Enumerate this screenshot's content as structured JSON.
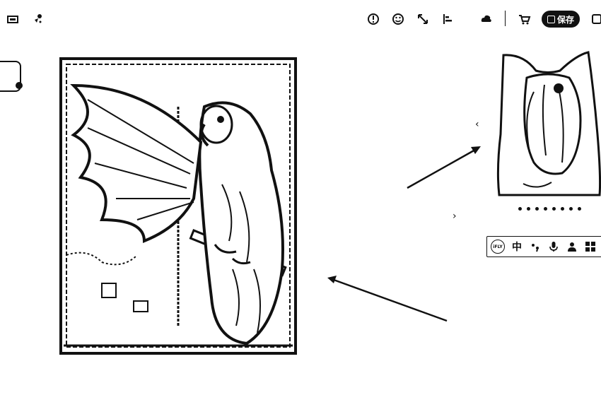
{
  "toolbar": {
    "left_icons": [
      "image-icon",
      "eyedropper-icon"
    ],
    "right_icons": [
      "info-icon",
      "smile-icon",
      "fullscreen-icon",
      "align-icon",
      "cloud-icon",
      "cart-icon"
    ],
    "save_label": "保存"
  },
  "ime_bar": {
    "logo_text": "iFLY",
    "lang_label": "中"
  },
  "preview": {
    "prev_arrow": "‹",
    "next_arrow": "›",
    "dot_count": 8
  }
}
